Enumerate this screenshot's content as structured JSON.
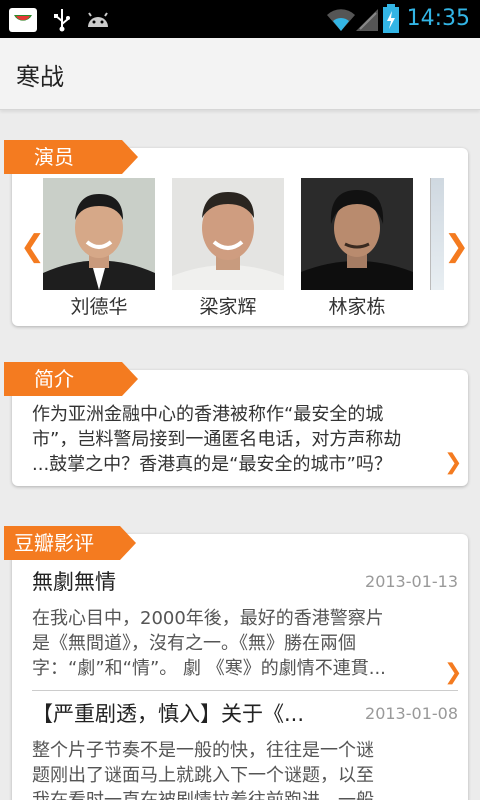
{
  "status": {
    "time": "14:35"
  },
  "header": {
    "title": "寒战"
  },
  "actors_section": {
    "label": "演员",
    "actors": [
      {
        "name": "刘德华"
      },
      {
        "name": "梁家辉"
      },
      {
        "name": "林家栋"
      }
    ],
    "prev_icon": "chevron-left",
    "next_icon": "chevron-right"
  },
  "intro_section": {
    "label": "简介",
    "text_line1": "作为亚洲金融中心的香港被称作“最安全的城",
    "text_line2": "市”，岂料警局接到一通匿名电话，对方声称劫",
    "text_line3": "...鼓掌之中？香港真的是“最安全的城市”吗？"
  },
  "reviews_section": {
    "label": "豆瓣影评",
    "reviews": [
      {
        "title": "無劇無情",
        "date": "2013-01-13",
        "line1": "在我心目中，2000年後，最好的香港警察片",
        "line2": "是《無間道》，沒有之一。《無》勝在兩個",
        "line3": "字：“劇”和“情”。 劇 《寒》的劇情不連貫..."
      },
      {
        "title": "【严重剧透，慎入】关于《...",
        "date": "2013-01-08",
        "line1": "整个片子节奏不是一般的快，往往是一个谜",
        "line2": "题刚出了谜面马上就跳入下一个谜题，以至",
        "line3": "我在看时一直在被剧情拉着往前跑进，一般"
      }
    ]
  },
  "colors": {
    "accent": "#f47b20",
    "status_time": "#33b5e5"
  }
}
